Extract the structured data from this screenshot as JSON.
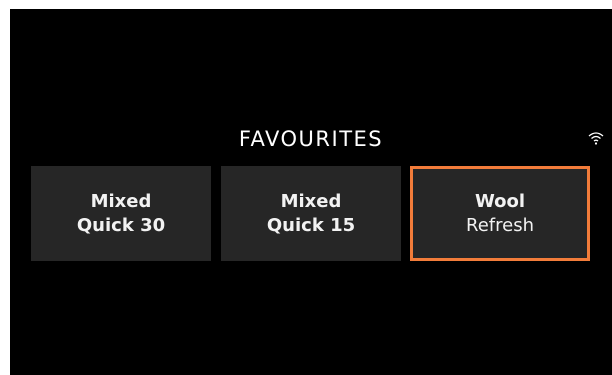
{
  "header": {
    "title": "FAVOURITES"
  },
  "status": {
    "wifi_icon": "wifi-icon"
  },
  "colors": {
    "background": "#000000",
    "tile": "#262626",
    "accent": "#f27c3a",
    "text": "#f2f2f2"
  },
  "favourites": [
    {
      "line1": "Mixed",
      "line2": "Quick 30",
      "selected": false
    },
    {
      "line1": "Mixed",
      "line2": "Quick 15",
      "selected": false
    },
    {
      "line1": "Wool",
      "line2": "Refresh",
      "selected": true
    }
  ]
}
